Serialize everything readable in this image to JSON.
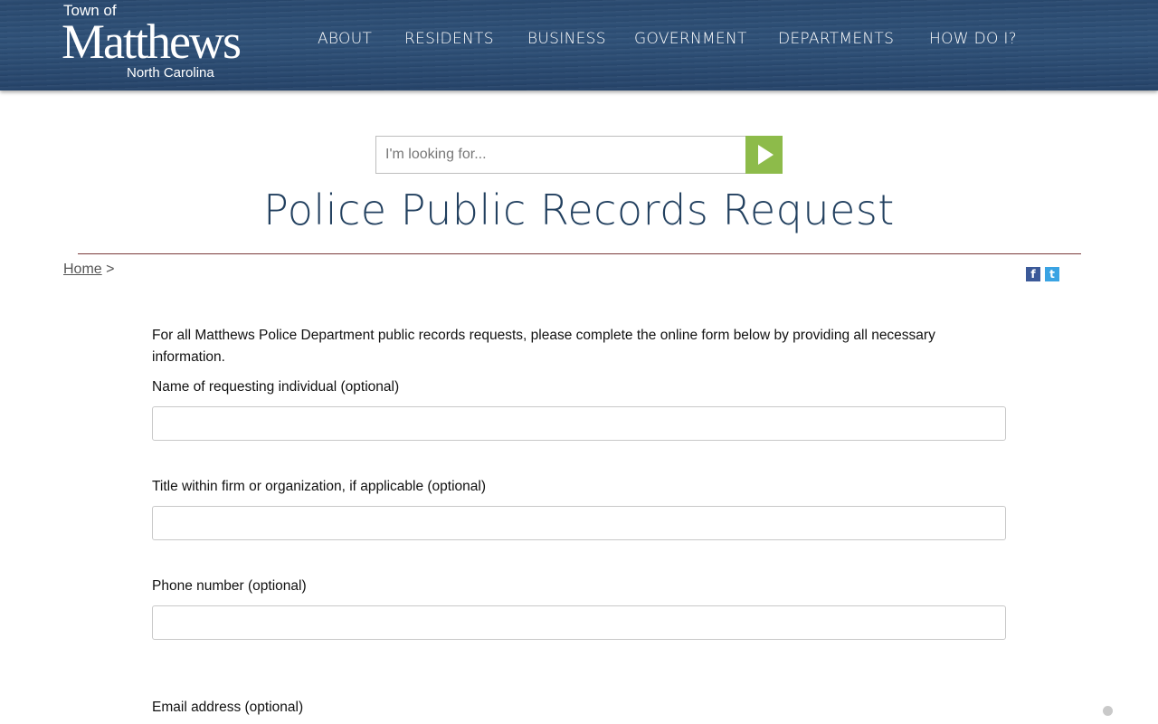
{
  "header": {
    "logo": {
      "town": "Town of",
      "name": "Matthews",
      "state": "North Carolina"
    },
    "nav": [
      "ABOUT",
      "RESIDENTS",
      "BUSINESS",
      "GOVERNMENT",
      "DEPARTMENTS",
      "HOW DO I?"
    ]
  },
  "search": {
    "placeholder": "I'm looking for...",
    "icon": "play-arrow-icon",
    "button_color": "#8dbb4a"
  },
  "page": {
    "title": "Police Public Records Request",
    "breadcrumb": {
      "home": "Home",
      "separator": ">"
    },
    "share": {
      "facebook": "f",
      "twitter": "t"
    }
  },
  "form": {
    "intro": "For all Matthews Police Department public records requests, please complete the online form below by providing all necessary information.",
    "fields": [
      {
        "label": "Name of requesting individual (optional)",
        "value": ""
      },
      {
        "label": "Title within firm or organization, if applicable (optional)",
        "value": ""
      },
      {
        "label": "Phone number (optional)",
        "value": ""
      },
      {
        "label": "Email address (optional)",
        "value": ""
      }
    ]
  },
  "colors": {
    "header": "#2c4b72",
    "title": "#22405f",
    "accent": "#8dbb4a",
    "rule": "#7a3b3b"
  }
}
